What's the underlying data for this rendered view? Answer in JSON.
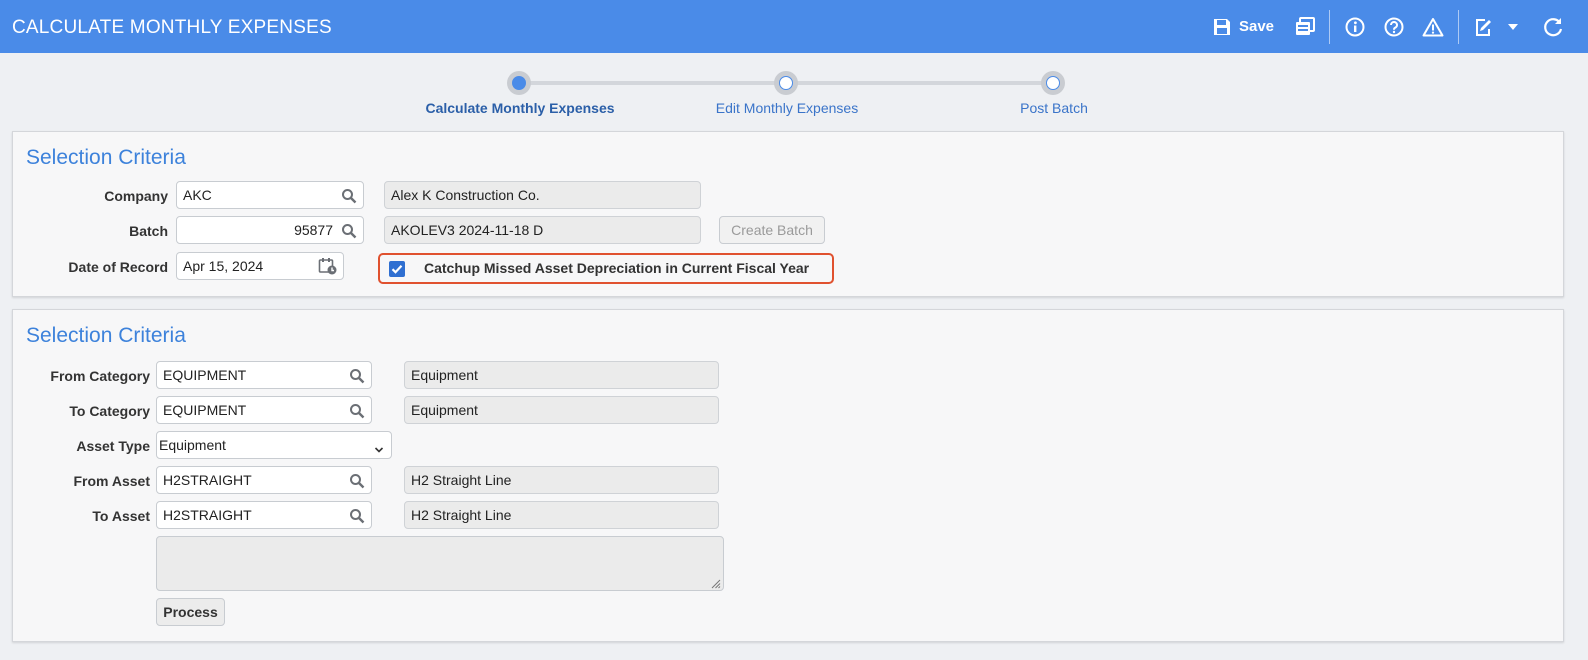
{
  "header": {
    "title": "CALCULATE MONTHLY EXPENSES",
    "save_label": "Save",
    "accent_color": "#4a8be8",
    "toolbar_icons": [
      "save-icon",
      "copy-icon",
      "info-icon",
      "help-icon",
      "warning-icon",
      "edit-icon",
      "chevron-down-icon",
      "refresh-icon"
    ]
  },
  "stepper": {
    "steps": [
      {
        "label": "Calculate Monthly Expenses",
        "active": true
      },
      {
        "label": "Edit Monthly Expenses",
        "active": false
      },
      {
        "label": "Post Batch",
        "active": false
      }
    ]
  },
  "panel1": {
    "title": "Selection Criteria",
    "company": {
      "label": "Company",
      "value": "AKC",
      "description": "Alex K Construction Co."
    },
    "batch": {
      "label": "Batch",
      "value": "95877",
      "description": "AKOLEV3 2024-11-18 D",
      "create_button": "Create Batch"
    },
    "date_of_record": {
      "label": "Date of Record",
      "value": "Apr 15, 2024"
    },
    "catchup": {
      "label": "Catchup Missed Asset Depreciation in Current Fiscal Year",
      "checked": true,
      "highlight_color": "#e0512f"
    }
  },
  "panel2": {
    "title": "Selection Criteria",
    "from_category": {
      "label": "From Category",
      "value": "EQUIPMENT",
      "description": "Equipment"
    },
    "to_category": {
      "label": "To Category",
      "value": "EQUIPMENT",
      "description": "Equipment"
    },
    "asset_type": {
      "label": "Asset Type",
      "value": "Equipment"
    },
    "from_asset": {
      "label": "From Asset",
      "value": "H2STRAIGHT",
      "description": "H2 Straight Line"
    },
    "to_asset": {
      "label": "To Asset",
      "value": "H2STRAIGHT",
      "description": "H2 Straight Line"
    },
    "notes": "",
    "process_button": "Process"
  }
}
